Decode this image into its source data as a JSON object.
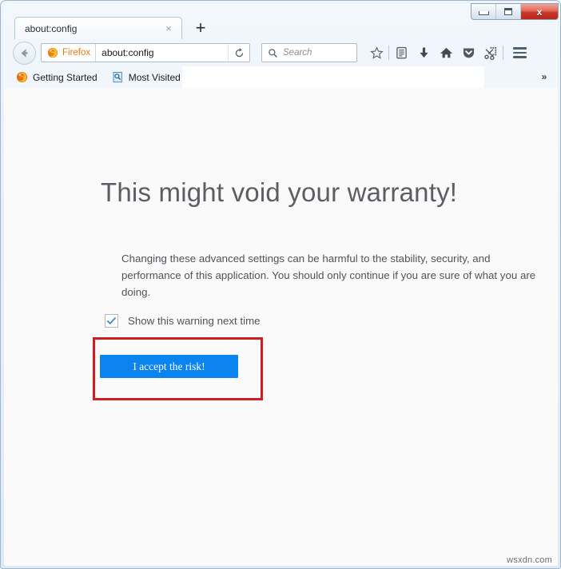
{
  "window": {
    "controls": {
      "minimize_label": "Minimize",
      "maximize_label": "Restore",
      "close_label": "x"
    }
  },
  "tabs": {
    "items": [
      {
        "title": "about:config",
        "close_label": "×"
      }
    ],
    "new_tab_label": "+"
  },
  "navbar": {
    "back_label": "Back",
    "identity_label": "Firefox",
    "url_value": "about:config",
    "reload_label": "Reload",
    "search": {
      "placeholder": "Search",
      "value": ""
    },
    "icons": [
      {
        "name": "bookmark-star-icon",
        "label": "Bookmark this page"
      },
      {
        "name": "library-icon",
        "label": "Show your bookmarks"
      },
      {
        "name": "download-icon",
        "label": "Downloads"
      },
      {
        "name": "home-icon",
        "label": "Home"
      },
      {
        "name": "pocket-icon",
        "label": "Save to Pocket"
      },
      {
        "name": "clip-scissors-icon",
        "label": "Clip"
      }
    ],
    "menu_label": "Open menu"
  },
  "bookmarks_bar": {
    "items": [
      {
        "label": "Getting Started",
        "icon": "firefox-icon"
      },
      {
        "label": "Most Visited",
        "icon": "most-visited-icon"
      }
    ],
    "overflow_label": "»"
  },
  "page": {
    "title": "This might void your warranty!",
    "body": "Changing these advanced settings can be harmful to the stability, security, and performance of this application. You should only continue if you are sure of what you are doing.",
    "checkbox": {
      "label": "Show this warning next time",
      "checked": true
    },
    "accept_button_label": "I accept the risk!"
  },
  "annotation": {
    "highlight_color": "#cc1f20",
    "target": "accept-risk-button"
  },
  "colors": {
    "button_blue": "#0b84f0",
    "firefox_orange": "#e07a18",
    "content_background": "#fafafa",
    "chrome_background": "#e9f1fa"
  },
  "watermark": "wsxdn.com"
}
